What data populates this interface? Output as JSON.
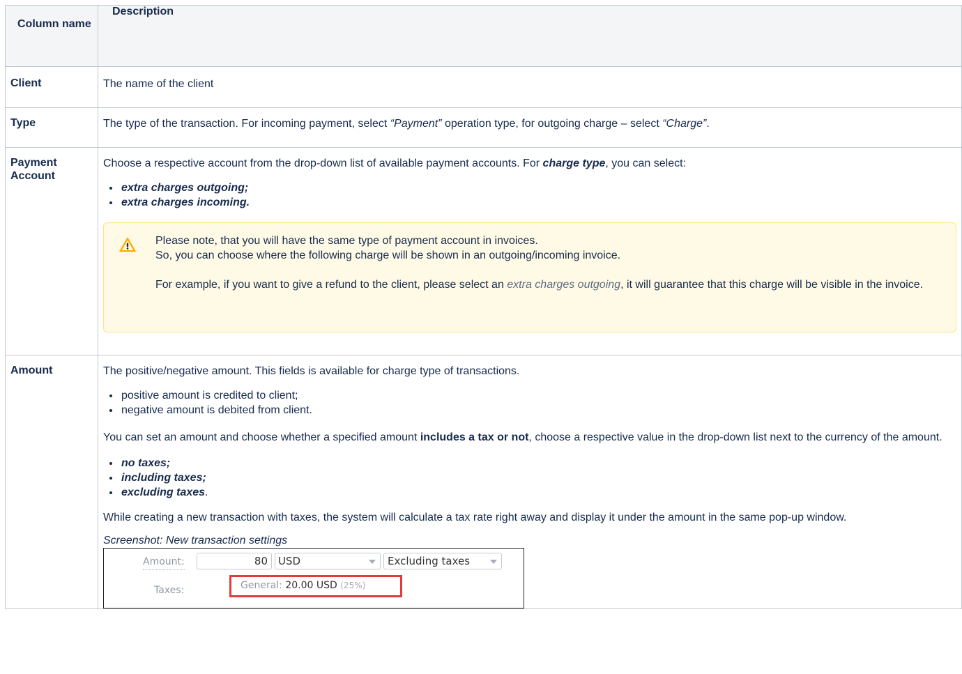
{
  "header": {
    "col1": "Column name",
    "col2": "Description"
  },
  "rows": {
    "client": {
      "name": "Client",
      "desc": "The name of the client"
    },
    "type": {
      "name": "Type",
      "desc_a": "The type of the transaction. For incoming payment, select ",
      "desc_b": "“Payment”",
      "desc_c": " operation type, for outgoing charge – select ",
      "desc_d": "“Charge”",
      "desc_e": "."
    },
    "payment": {
      "name": "Payment Account",
      "desc_a": "Choose a respective account from the drop-down list of available payment accounts. For ",
      "desc_b": "charge type",
      "desc_c": ", you can select:",
      "items": [
        "extra charges outgoing;",
        "extra charges incoming."
      ],
      "note": {
        "line1": "Please note, that you will have the same type of payment account in invoices.",
        "line2": "So, you can choose where the following charge will be shown in an outgoing/incoming invoice.",
        "line3_a": "For example, if you want to give a refund to the client, please select an ",
        "line3_b": "extra charges outgoing",
        "line3_c": ", it will guarantee that this charge will be visible in the invoice."
      }
    },
    "amount": {
      "name": "Amount",
      "desc": "The positive/negative amount. This fields is available for charge type of transactions.",
      "items": [
        "positive amount is credited to client;",
        "negative amount is debited from client."
      ],
      "para_a": "You can set an amount and choose whether a specified amount ",
      "para_b": "includes a tax or not",
      "para_c": ", choose a respective value in the drop-down list next to the currency of the amount.",
      "tax_items": [
        "no taxes;",
        "including taxes;",
        "excluding taxes"
      ],
      "tax_last_suffix": ".",
      "para2": "While creating a new transaction with taxes, the system will calculate a tax rate right away and display it under the amount in the same pop-up window.",
      "caption": "Screenshot: New transaction settings",
      "shot": {
        "amount_label": "Amount:",
        "amount_value": "80",
        "currency": "USD",
        "tax_mode": "Excluding taxes",
        "taxes_label": "Taxes:",
        "general_label": "General: ",
        "general_value": "20.00 USD",
        "general_pct": "(25%)"
      }
    }
  },
  "colors": {
    "border": "#c1c7d0",
    "header_bg": "#f4f5f7",
    "note_bg": "#fffae6",
    "note_border": "#ffe380",
    "highlight": "#e03c3c"
  },
  "icons": {
    "note_icon": "warning-icon"
  }
}
